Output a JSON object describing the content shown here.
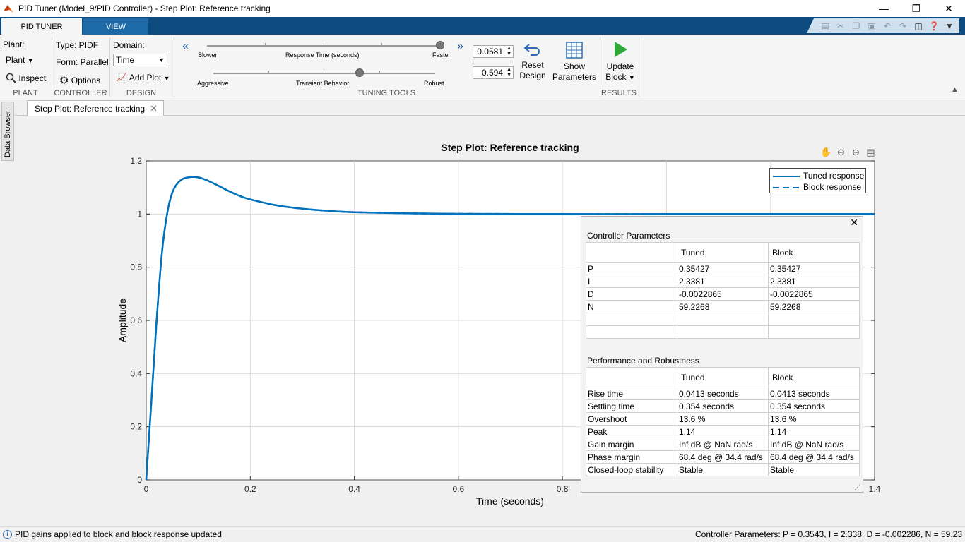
{
  "window": {
    "title": "PID Tuner (Model_9/PID Controller) - Step Plot: Reference tracking"
  },
  "ribbon_tabs": [
    {
      "label": "PID TUNER"
    },
    {
      "label": "VIEW"
    }
  ],
  "plant": {
    "label": "Plant:",
    "dropdown": "Plant",
    "inspect": "Inspect",
    "group": "PLANT"
  },
  "controller": {
    "type": "Type: PIDF",
    "form": "Form: Parallel",
    "options": "Options",
    "group": "CONTROLLER"
  },
  "design": {
    "domain_label": "Domain:",
    "domain_value": "Time",
    "add_plot": "Add Plot",
    "group": "DESIGN"
  },
  "tuning": {
    "slower": "Slower",
    "response_time": "Response Time (seconds)",
    "faster": "Faster",
    "aggressive": "Aggressive",
    "transient": "Transient Behavior",
    "robust": "Robust",
    "response_value": "0.0581",
    "transient_value": "0.594",
    "response_slider_fraction": 1.0,
    "transient_slider_fraction": 0.66,
    "group": "TUNING TOOLS",
    "reset_line1": "Reset",
    "reset_line2": "Design",
    "show_line1": "Show",
    "show_line2": "Parameters"
  },
  "results": {
    "update_line1": "Update",
    "update_line2": "Block",
    "group": "RESULTS"
  },
  "doc_tab": {
    "label": "Step Plot: Reference tracking"
  },
  "data_browser": {
    "label": "Data Browser"
  },
  "chart_data": {
    "type": "line",
    "title": "Step Plot: Reference tracking",
    "xlabel": "Time (seconds)",
    "ylabel": "Amplitude",
    "xlim": [
      0,
      1.4
    ],
    "ylim": [
      0,
      1.2
    ],
    "xticks": [
      "0",
      "0.2",
      "0.4",
      "0.6",
      "0.8",
      "1",
      "1.2",
      "1.4"
    ],
    "yticks": [
      "0",
      "0.2",
      "0.4",
      "0.6",
      "0.8",
      "1",
      "1.2"
    ],
    "grid": true,
    "legend_position": "top-right",
    "series": [
      {
        "name": "Tuned response",
        "style": "solid",
        "color": "#0072bd",
        "x": [
          0,
          0.01,
          0.02,
          0.03,
          0.04,
          0.05,
          0.06,
          0.07,
          0.08,
          0.09,
          0.1,
          0.11,
          0.12,
          0.14,
          0.16,
          0.18,
          0.2,
          0.25,
          0.3,
          0.35,
          0.4,
          0.5,
          0.6,
          0.8,
          1.0,
          1.2,
          1.4
        ],
        "y": [
          0,
          0.3,
          0.6,
          0.85,
          1.0,
          1.08,
          1.115,
          1.132,
          1.138,
          1.14,
          1.138,
          1.132,
          1.124,
          1.105,
          1.085,
          1.068,
          1.055,
          1.033,
          1.02,
          1.012,
          1.007,
          1.003,
          1.001,
          1.0,
          1.0,
          1.0,
          1.0
        ]
      },
      {
        "name": "Block response",
        "style": "dashed",
        "color": "#0072bd",
        "x": [
          0,
          0.01,
          0.02,
          0.03,
          0.04,
          0.05,
          0.06,
          0.07,
          0.08,
          0.09,
          0.1,
          0.11,
          0.12,
          0.14,
          0.16,
          0.18,
          0.2,
          0.25,
          0.3,
          0.35,
          0.4,
          0.5,
          0.6,
          0.8,
          1.0,
          1.2,
          1.4
        ],
        "y": [
          0,
          0.3,
          0.6,
          0.85,
          1.0,
          1.08,
          1.115,
          1.132,
          1.138,
          1.14,
          1.138,
          1.132,
          1.124,
          1.105,
          1.085,
          1.068,
          1.055,
          1.033,
          1.02,
          1.012,
          1.007,
          1.003,
          1.001,
          1.0,
          1.0,
          1.0,
          1.0
        ]
      }
    ]
  },
  "params_panel": {
    "controller_header": "Controller Parameters",
    "columns": [
      "",
      "Tuned",
      "Block"
    ],
    "controller_rows": [
      [
        "P",
        "0.35427",
        "0.35427"
      ],
      [
        "I",
        "2.3381",
        "2.3381"
      ],
      [
        "D",
        "-0.0022865",
        "-0.0022865"
      ],
      [
        "N",
        "59.2268",
        "59.2268"
      ],
      [
        "",
        "",
        ""
      ],
      [
        "",
        "",
        ""
      ]
    ],
    "performance_header": "Performance and Robustness",
    "performance_rows": [
      [
        "Rise time",
        "0.0413 seconds",
        "0.0413 seconds"
      ],
      [
        "Settling time",
        "0.354 seconds",
        "0.354 seconds"
      ],
      [
        "Overshoot",
        "13.6 %",
        "13.6 %"
      ],
      [
        "Peak",
        "1.14",
        "1.14"
      ],
      [
        "Gain margin",
        "Inf dB @ NaN rad/s",
        "Inf dB @ NaN rad/s"
      ],
      [
        "Phase margin",
        "68.4 deg @ 34.4 rad/s",
        "68.4 deg @ 34.4 rad/s"
      ],
      [
        "Closed-loop stability",
        "Stable",
        "Stable"
      ]
    ]
  },
  "status": {
    "left": "PID gains applied to block and block response updated",
    "right": "Controller Parameters: P = 0.3543, I = 2.338, D = -0.002286, N = 59.23"
  }
}
